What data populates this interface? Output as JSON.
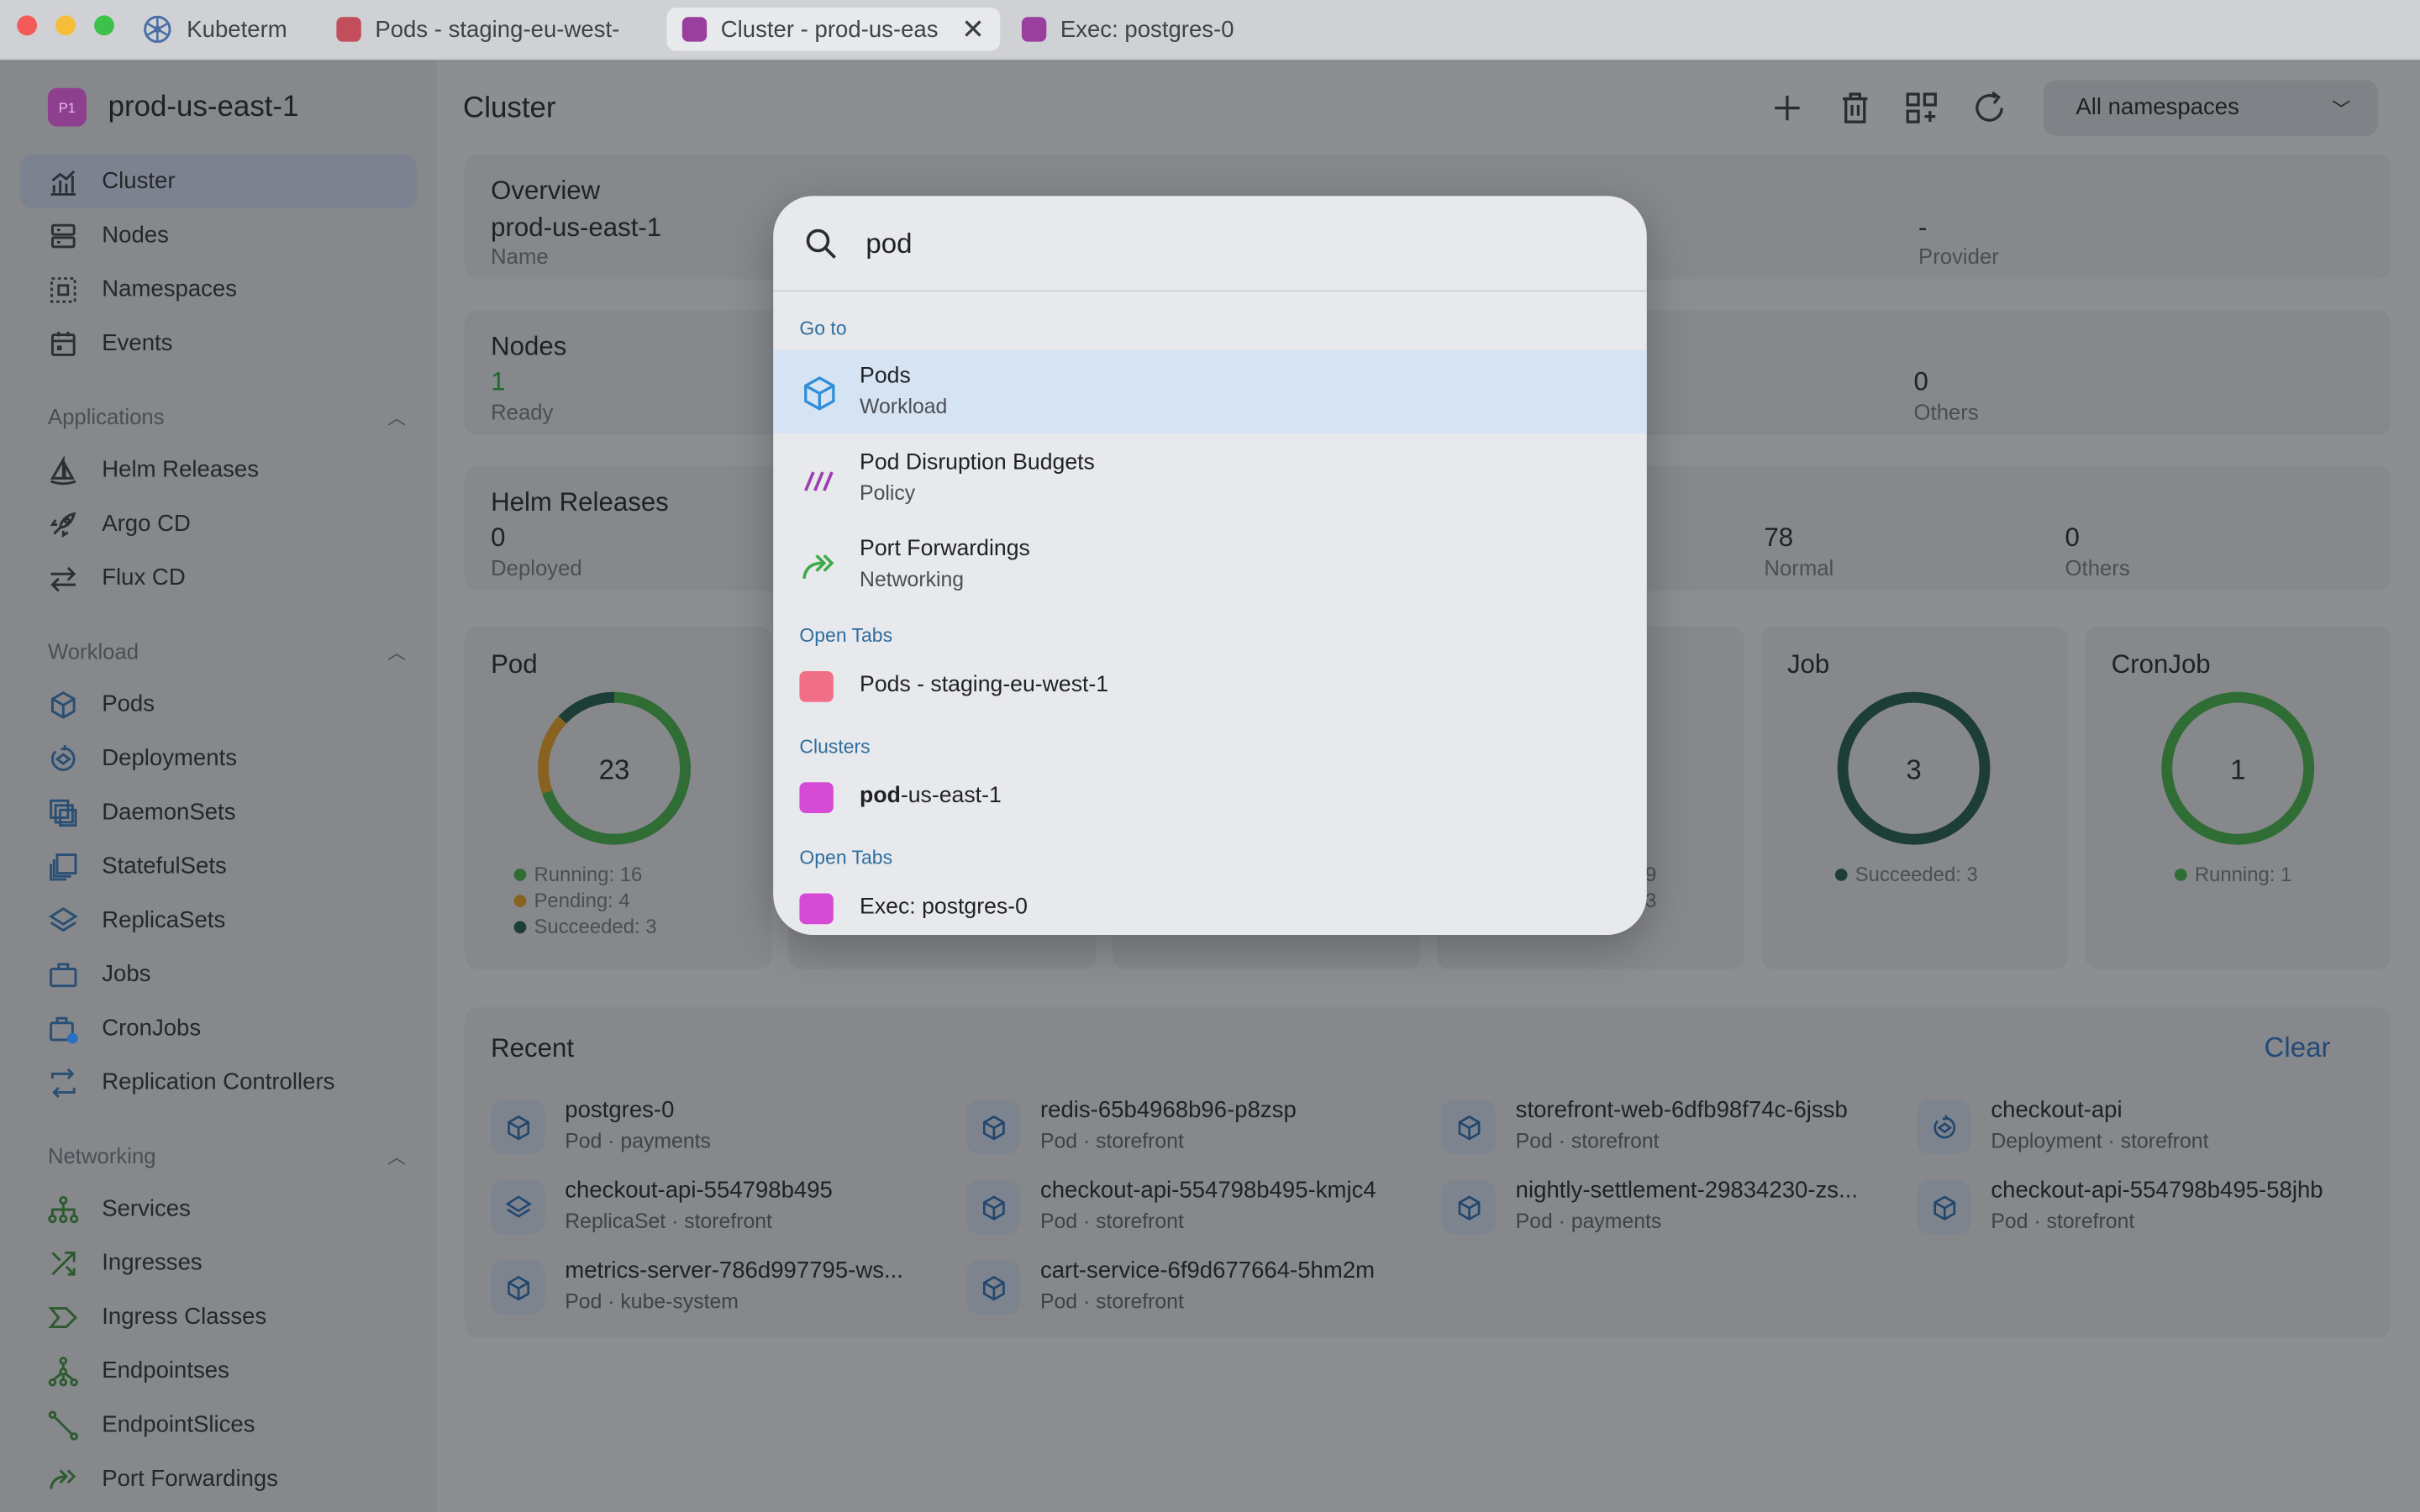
{
  "window": {
    "tabs": [
      {
        "label": "Kubeterm",
        "color": "#4a6fa5",
        "icon": "kubernetes-icon"
      },
      {
        "label": "Pods - staging-eu-west-",
        "color": "#c24d5b"
      },
      {
        "label": "Cluster - prod-us-eas",
        "color": "#9b3f9f",
        "active": true
      },
      {
        "label": "Exec: postgres-0",
        "color": "#9b3f9f"
      }
    ]
  },
  "sidebar": {
    "cluster_badge": "P1",
    "cluster_name": "prod-us-east-1",
    "top_items": [
      {
        "label": "Cluster",
        "icon": "chart-icon",
        "selected": true
      },
      {
        "label": "Nodes",
        "icon": "server-icon"
      },
      {
        "label": "Namespaces",
        "icon": "namespace-icon"
      },
      {
        "label": "Events",
        "icon": "calendar-icon"
      }
    ],
    "applications": {
      "label": "Applications",
      "items": [
        {
          "label": "Helm Releases",
          "icon": "helm-icon"
        },
        {
          "label": "Argo CD",
          "icon": "rocket-icon"
        },
        {
          "label": "Flux CD",
          "icon": "sync-arrows-icon"
        }
      ]
    },
    "workload": {
      "label": "Workload",
      "items": [
        {
          "label": "Pods",
          "icon": "cube-icon"
        },
        {
          "label": "Deployments",
          "icon": "deploy-icon"
        },
        {
          "label": "DaemonSets",
          "icon": "layers-icon"
        },
        {
          "label": "StatefulSets",
          "icon": "stack-icon"
        },
        {
          "label": "ReplicaSets",
          "icon": "replica-icon"
        },
        {
          "label": "Jobs",
          "icon": "briefcase-icon"
        },
        {
          "label": "CronJobs",
          "icon": "cron-icon"
        },
        {
          "label": "Replication Controllers",
          "icon": "replication-icon"
        }
      ]
    },
    "networking": {
      "label": "Networking",
      "items": [
        {
          "label": "Services",
          "icon": "network-icon"
        },
        {
          "label": "Ingresses",
          "icon": "shuffle-icon"
        },
        {
          "label": "Ingress Classes",
          "icon": "chevron-path-icon"
        },
        {
          "label": "Endpointses",
          "icon": "endpoints-icon"
        },
        {
          "label": "EndpointSlices",
          "icon": "line-icon"
        },
        {
          "label": "Port Forwardings",
          "icon": "forward-icon"
        }
      ]
    }
  },
  "main": {
    "title": "Cluster",
    "namespace_select": "All namespaces",
    "overview": {
      "title": "Overview",
      "name_value": "prod-us-east-1",
      "name_label": "Name",
      "provider_value": "-",
      "provider_label": "Provider"
    },
    "nodes": {
      "title": "Nodes",
      "ready_value": "1",
      "ready_label": "Ready",
      "others_value": "0",
      "others_label": "Others"
    },
    "helm": {
      "title": "Helm Releases",
      "deployed_value": "0",
      "deployed_label": "Deployed",
      "normal_value": "78",
      "normal_label": "Normal",
      "others_value": "0",
      "others_label": "Others"
    },
    "pod_card": {
      "title": "Pod",
      "total": "23",
      "running": "Running: 16",
      "pending": "Pending: 4",
      "succeeded": "Succeeded: 3",
      "segments": [
        16,
        4,
        3
      ]
    },
    "job_card": {
      "title": "Job",
      "total": "3",
      "legend": "Succeeded: 3"
    },
    "cronjob_card": {
      "title": "CronJob",
      "total": "1",
      "legend": "Running: 1"
    },
    "partial_card": {
      "line1": "9",
      "line2": "3"
    },
    "recent": {
      "title": "Recent",
      "clear": "Clear",
      "items": [
        {
          "name": "postgres-0",
          "meta": "Pod · payments",
          "icon": "cube-icon"
        },
        {
          "name": "redis-65b4968b96-p8zsp",
          "meta": "Pod · storefront",
          "icon": "cube-icon"
        },
        {
          "name": "storefront-web-6dfb98f74c-6jssb",
          "meta": "Pod · storefront",
          "icon": "cube-icon"
        },
        {
          "name": "checkout-api",
          "meta": "Deployment · storefront",
          "icon": "deploy-icon"
        },
        {
          "name": "checkout-api-554798b495",
          "meta": "ReplicaSet · storefront",
          "icon": "replica-icon"
        },
        {
          "name": "checkout-api-554798b495-kmjc4",
          "meta": "Pod · storefront",
          "icon": "cube-icon"
        },
        {
          "name": "nightly-settlement-29834230-zs...",
          "meta": "Pod · payments",
          "icon": "cube-icon"
        },
        {
          "name": "checkout-api-554798b495-58jhb",
          "meta": "Pod · storefront",
          "icon": "cube-icon"
        },
        {
          "name": "metrics-server-786d997795-ws...",
          "meta": "Pod · kube-system",
          "icon": "cube-icon"
        },
        {
          "name": "cart-service-6f9d677664-5hm2m",
          "meta": "Pod · storefront",
          "icon": "cube-icon"
        }
      ]
    }
  },
  "palette": {
    "query": "pod",
    "goto_label": "Go to",
    "goto": [
      {
        "title": "Pods",
        "subtitle": "Workload",
        "icon": "cube-icon",
        "highlighted": true
      },
      {
        "title": "Pod Disruption Budgets",
        "subtitle": "Policy",
        "icon": "slashes-icon"
      },
      {
        "title": "Port Forwardings",
        "subtitle": "Networking",
        "icon": "forward-icon"
      }
    ],
    "open_tabs_label": "Open Tabs",
    "open_tab_1": {
      "title": "Pods - staging-eu-west-1",
      "color": "#f06f87"
    },
    "clusters_label": "Clusters",
    "cluster_match_bold": "pod",
    "cluster_match_rest": "-us-east-1",
    "cluster_color": "#d64bd6",
    "open_tabs_label_2": "Open Tabs",
    "open_tab_2": {
      "title": "Exec: postgres-0",
      "color": "#d64bd6"
    }
  }
}
